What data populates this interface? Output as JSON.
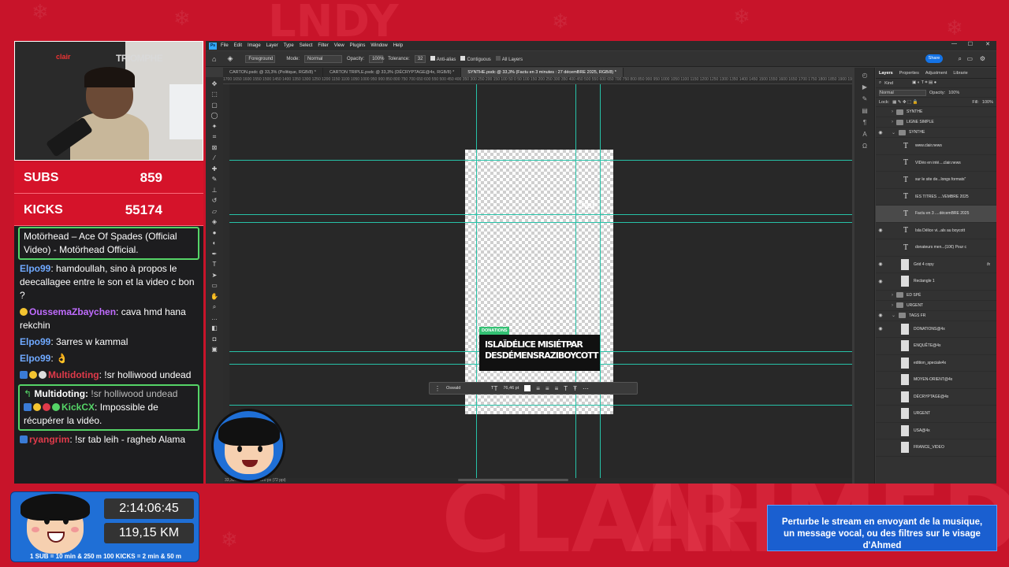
{
  "stream": {
    "subs_label": "SUBS",
    "subs_value": "859",
    "kicks_label": "KICKS",
    "kicks_value": "55174",
    "timer": "2:14:06:45",
    "distance": "119,15 KM",
    "rule_text": "1 SUB = 10 min & 250 m    100 KICKS = 2 min & 50 m",
    "banner_line1": "Perturbe le stream en envoyant de la musique,",
    "banner_line2": "un message vocal, ou des filtres sur le visage d'Ahmed",
    "cam_logo": "clair",
    "cam_poster": "TRIOMPHE"
  },
  "chat": {
    "messages": [
      {
        "user": "",
        "text": "Motörhead – Ace Of Spades (Official Video) - Motörhead Official.",
        "highlight": true
      },
      {
        "user": "Elpo99",
        "text": ": hamdoullah, sino à propos le deecallagee entre le son et la video c bon ?",
        "color": "#6fa9ff"
      },
      {
        "user": "OussemaZbaychen",
        "text": ": cava hmd hana rekchin",
        "color": "#c06cff"
      },
      {
        "user": "Elpo99",
        "text": ": 3arres w kammal",
        "color": "#6fa9ff"
      },
      {
        "user": "Elpo99",
        "text": ": 👌",
        "color": "#6fa9ff"
      },
      {
        "user": "Multidoting",
        "text": ": !sr holliwood undead",
        "color": "#e03a4a"
      },
      {
        "user": "Multidoting:",
        "text": " !sr holliwood undead",
        "reply": "KickCX",
        "reply_text": ": Impossible de récupérer la vidéo.",
        "highlight": true
      },
      {
        "user": "ryangrim",
        "text": ": !sr tab leih - ragheb Alama",
        "color": "#e03a4a"
      }
    ]
  },
  "ps": {
    "menu": [
      "File",
      "Edit",
      "Image",
      "Layer",
      "Type",
      "Select",
      "Filter",
      "View",
      "Plugins",
      "Window",
      "Help"
    ],
    "options": {
      "sample": "Foreground",
      "mode_label": "Mode:",
      "mode": "Normal",
      "opacity_label": "Opacity:",
      "opacity": "100%",
      "tolerance_label": "Tolerance:",
      "tolerance": "32",
      "antialias": "Anti-alias",
      "contiguous": "Contiguous",
      "all_layers": "All Layers"
    },
    "share": "Share",
    "tabs": [
      "CARTON.psdc @ 33,3% (Politique, RGB/8) *",
      "CARTON TRIPLE.psdc @ 33,3% (DÉCRYPTAGE@4x, RGB/8) *",
      "SYNTHE.psdc @ 33,3% (Factu en 3 minutes : 27 décemBRE 2025, RGB/8) *"
    ],
    "ruler": "1700 1650 1600 1550 1500 1450 1400 1350 1300 1250 1200 1150 1100 1050 1000 950 900 850 800 750 700 650 600 550 500 450 400 350 300 250 200 150 100 50 0 50 100 150 200 250 300 350 400 450 500 550 600 650 700 750 800 850 900 950 1000 1050 1100 1150 1200 1250 1300 1350 1400 1450 1500 1550 1600 1650 1700 1750 1800 1850 1900 1950 2000 2050 2100 2150 2200 2250 2300 2350",
    "donations_tag": "DONATIONS",
    "donations_line1": "ISLAÏDÉLICE MISIÉTPAR",
    "donations_line2": "DESDÉMENSRAZIBOYCOTT",
    "watermark": "clair",
    "ctx_font": "Oswald",
    "ctx_size": "76,46 pt",
    "status": "33,33%    1080 px x 1920 px (72 ppi)",
    "panel_tabs": [
      "Layers",
      "Properties",
      "Adjustment",
      "Librarie"
    ],
    "kind": "Kind",
    "blend": "Normal",
    "opacity_label": "Opacity:",
    "opacity": "100%",
    "lock_label": "Lock:",
    "fill_label": "Fill:",
    "fill": "100%",
    "layers": [
      {
        "name": "SYNTHE",
        "type": "group",
        "eye": false
      },
      {
        "name": "LIGNE SIMPLE",
        "type": "group",
        "eye": false
      },
      {
        "name": "SYNTHE",
        "type": "group-open",
        "eye": true
      },
      {
        "name": "www.clair.news",
        "type": "text",
        "eye": false
      },
      {
        "name": "VIDéo en inté....clair.news",
        "type": "text",
        "eye": false
      },
      {
        "name": "sur le site de...longs formats\"",
        "type": "text",
        "eye": false
      },
      {
        "name": "IES TITRES ....VEMBRE 2025",
        "type": "text",
        "eye": false
      },
      {
        "name": "Factu en 3 ....décemBRE 2025",
        "type": "text",
        "eye": false,
        "selected": true
      },
      {
        "name": "Isla Délice vi...als au boycott",
        "type": "text",
        "eye": true
      },
      {
        "name": "donateurs men...(10€) Pour c",
        "type": "text",
        "eye": false
      },
      {
        "name": "Grid 4 copy",
        "type": "smart",
        "eye": true,
        "fx": "fx"
      },
      {
        "name": "Rectangle 1",
        "type": "image",
        "eye": true
      },
      {
        "name": "ED SPÉ",
        "type": "group",
        "eye": false
      },
      {
        "name": "URGENT",
        "type": "group",
        "eye": false
      },
      {
        "name": "TAGS FR",
        "type": "group-open",
        "eye": true
      },
      {
        "name": "DONATIONS@4x",
        "type": "image",
        "eye": true
      },
      {
        "name": "ENQUÊTE@4x",
        "type": "image",
        "eye": false
      },
      {
        "name": "edition_speciale4x",
        "type": "image",
        "eye": false
      },
      {
        "name": "MOYEN-ORIENT@4x",
        "type": "image",
        "eye": false
      },
      {
        "name": "DÉCRYPTAGE@4x",
        "type": "image",
        "eye": false
      },
      {
        "name": "URGENT",
        "type": "image",
        "eye": false
      },
      {
        "name": "USA@4x",
        "type": "image",
        "eye": false
      },
      {
        "name": "FRANCE_VIDEO",
        "type": "image",
        "eye": false
      }
    ]
  },
  "colors": {
    "accent": "#d5132a",
    "ps_blue": "#31a8ff",
    "guide": "#27c2a8",
    "donation_green": "#33c173",
    "banner": "#1a5fd0"
  }
}
